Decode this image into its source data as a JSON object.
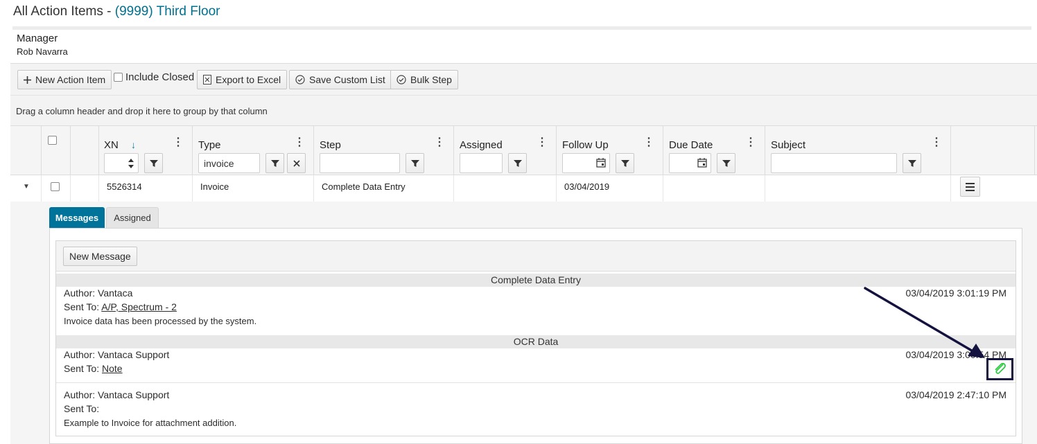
{
  "header": {
    "title_prefix": "All Action Items - ",
    "title_link": "(9999) Third Floor",
    "manager_label": "Manager",
    "manager_name": "Rob Navarra"
  },
  "toolbar": {
    "new_action_item": "New Action Item",
    "include_closed": "Include Closed",
    "export_excel": "Export to Excel",
    "save_custom_list": "Save Custom List",
    "bulk_step": "Bulk Step"
  },
  "group_hint": "Drag a column header and drop it here to group by that column",
  "columns": {
    "xn": "XN",
    "type": "Type",
    "step": "Step",
    "assigned": "Assigned",
    "follow_up": "Follow Up",
    "due_date": "Due Date",
    "subject": "Subject"
  },
  "filters": {
    "type_value": "invoice"
  },
  "row": {
    "xn": "5526314",
    "type": "Invoice",
    "step": "Complete Data Entry",
    "assigned": "",
    "follow_up": "03/04/2019",
    "due_date": "",
    "subject": ""
  },
  "tabs": {
    "messages": "Messages",
    "assigned": "Assigned"
  },
  "messages_panel": {
    "new_message": "New Message",
    "groups": [
      {
        "name": "Complete Data Entry",
        "messages": [
          {
            "author": "Author: Vantaca",
            "sent_to_label": "Sent To: ",
            "sent_to": "A/P, Spectrum - 2",
            "body": "Invoice data has been processed by the system.",
            "date": "03/04/2019 3:01:19 PM"
          }
        ]
      },
      {
        "name": "OCR Data",
        "messages": [
          {
            "author": "Author: Vantaca Support",
            "sent_to_label": "Sent To: ",
            "sent_to": "Note",
            "body": "",
            "date": "03/04/2019 3:00:54 PM"
          },
          {
            "author": "Author: Vantaca Support",
            "sent_to_label": "Sent To:",
            "sent_to": "",
            "body": "Example to Invoice for attachment addition.",
            "date": "03/04/2019 2:47:10 PM"
          }
        ]
      }
    ]
  },
  "colors": {
    "accent": "#00739a",
    "link": "#00708f",
    "annotation": "#14133f",
    "attachment_icon": "#2ecc40"
  },
  "icons": {
    "attachment": "paperclip-icon",
    "annotation_arrow": "arrow-annotation"
  }
}
